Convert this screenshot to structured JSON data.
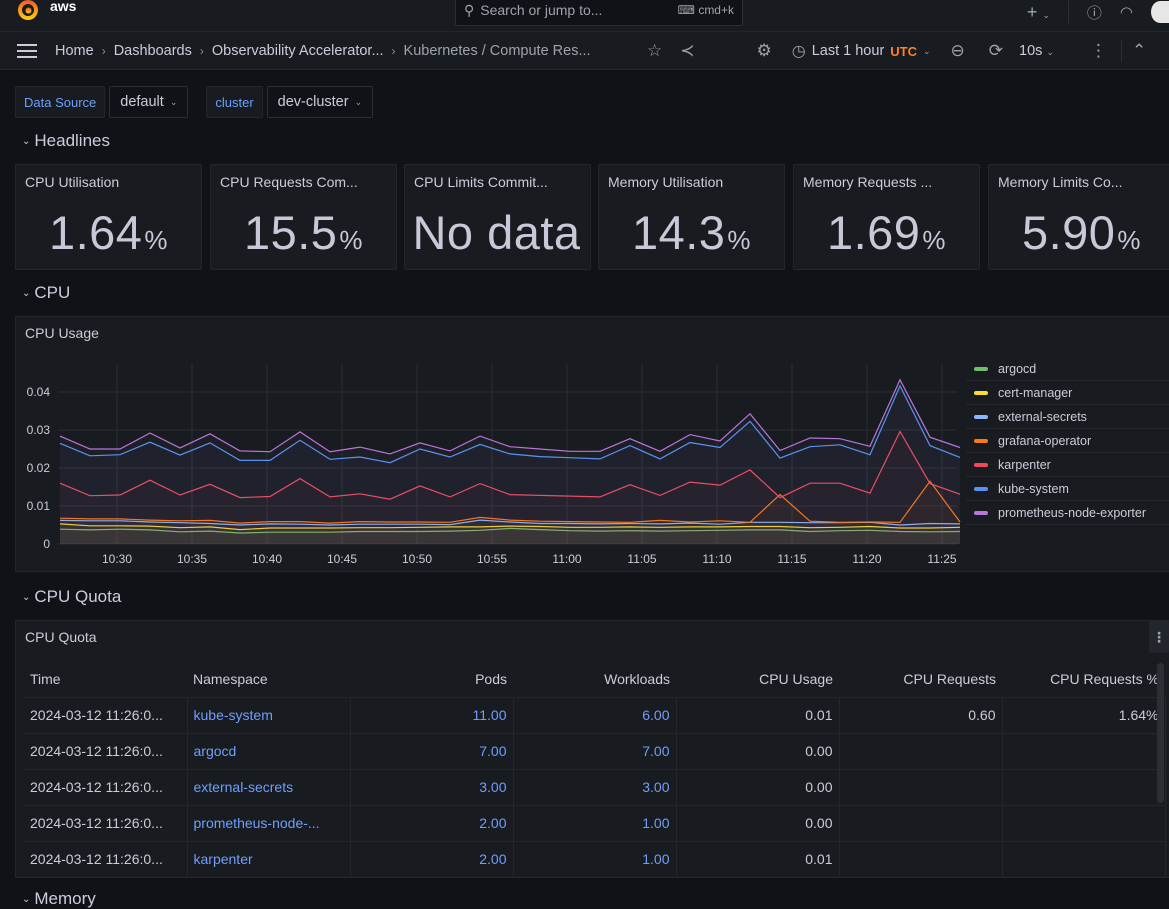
{
  "topbar": {
    "brand": "aws",
    "search_placeholder": "Search or jump to...",
    "search_shortcut": "cmd+k",
    "icons": [
      "grafana-logo-icon",
      "search-icon",
      "keyboard-icon",
      "plus-icon",
      "help-icon",
      "rss-icon",
      "avatar"
    ]
  },
  "navbar": {
    "breadcrumbs": [
      "Home",
      "Dashboards",
      "Observability Accelerator...",
      "Kubernetes / Compute Res..."
    ],
    "time_range": "Last 1 hour",
    "timezone": "UTC",
    "refresh_interval": "10s",
    "accent_utc": "#ff7f2a"
  },
  "variables": [
    {
      "label": "Data Source",
      "value": "default"
    },
    {
      "label": "cluster",
      "value": "dev-cluster"
    }
  ],
  "rows": {
    "headlines": "Headlines",
    "cpu": "CPU",
    "cpu_quota": "CPU Quota",
    "memory": "Memory"
  },
  "stats": [
    {
      "title": "CPU Utilisation",
      "value": "1.64",
      "unit": "%"
    },
    {
      "title": "CPU Requests Com...",
      "value": "15.5",
      "unit": "%"
    },
    {
      "title": "CPU Limits Commit...",
      "value": "No data",
      "unit": ""
    },
    {
      "title": "Memory Utilisation",
      "value": "14.3",
      "unit": "%"
    },
    {
      "title": "Memory Requests ...",
      "value": "1.69",
      "unit": "%"
    },
    {
      "title": "Memory Limits Co...",
      "value": "5.90",
      "unit": "%"
    }
  ],
  "cpu_usage_panel": {
    "title": "CPU Usage"
  },
  "chart_data": {
    "type": "line",
    "title": "CPU Usage",
    "xlabel": "",
    "ylabel": "",
    "ylim": [
      0,
      0.045
    ],
    "yticks": [
      "0",
      "0.01",
      "0.02",
      "0.03",
      "0.04"
    ],
    "xticks": [
      "10:30",
      "10:35",
      "10:40",
      "10:45",
      "10:50",
      "10:55",
      "11:00",
      "11:05",
      "11:10",
      "11:15",
      "11:20",
      "11:25"
    ],
    "x_start_minutes": 26.2,
    "x_step_minutes": 2,
    "grid": true,
    "legend": "right",
    "series": [
      {
        "name": "argocd",
        "color": "#73bf69",
        "values": [
          0.0039,
          0.0037,
          0.0039,
          0.0037,
          0.0032,
          0.0034,
          0.0029,
          0.0031,
          0.0031,
          0.0031,
          0.0033,
          0.0033,
          0.0033,
          0.0034,
          0.0036,
          0.0041,
          0.0038,
          0.0035,
          0.0034,
          0.0035,
          0.0034,
          0.0035,
          0.0036,
          0.0037,
          0.0037,
          0.0033,
          0.0035,
          0.0036,
          0.0033,
          0.0032,
          0.0033
        ]
      },
      {
        "name": "cert-manager",
        "color": "#fade2a",
        "values": [
          0.0053,
          0.0048,
          0.0048,
          0.0047,
          0.0043,
          0.0045,
          0.0038,
          0.0042,
          0.0042,
          0.0042,
          0.0043,
          0.0043,
          0.0044,
          0.0045,
          0.0045,
          0.0047,
          0.0046,
          0.0044,
          0.0044,
          0.0045,
          0.0044,
          0.0045,
          0.0045,
          0.0046,
          0.0046,
          0.0043,
          0.0044,
          0.0046,
          0.0042,
          0.0042,
          0.0044
        ]
      },
      {
        "name": "external-secrets",
        "color": "#8ab8ff",
        "values": [
          0.0062,
          0.0061,
          0.0061,
          0.0058,
          0.0056,
          0.0054,
          0.005,
          0.0053,
          0.0052,
          0.005,
          0.0052,
          0.0052,
          0.0052,
          0.0051,
          0.0063,
          0.0058,
          0.0054,
          0.0054,
          0.0053,
          0.0054,
          0.0053,
          0.0055,
          0.0052,
          0.0057,
          0.0057,
          0.0056,
          0.0056,
          0.0057,
          0.005,
          0.0054,
          0.0053
        ]
      },
      {
        "name": "grafana-operator",
        "color": "#ff780a",
        "values": [
          0.0068,
          0.0066,
          0.0066,
          0.0063,
          0.0061,
          0.0062,
          0.0055,
          0.0059,
          0.0059,
          0.0055,
          0.0059,
          0.0058,
          0.0058,
          0.0057,
          0.007,
          0.0063,
          0.006,
          0.0059,
          0.0058,
          0.0057,
          0.0062,
          0.0058,
          0.0061,
          0.0057,
          0.013,
          0.006,
          0.0057,
          0.0058,
          0.0057,
          0.0165,
          0.0058
        ]
      },
      {
        "name": "karpenter",
        "color": "#f2495c",
        "values": [
          0.016,
          0.0127,
          0.0129,
          0.0168,
          0.0129,
          0.0157,
          0.0122,
          0.0125,
          0.0172,
          0.0124,
          0.0132,
          0.0118,
          0.0153,
          0.0124,
          0.0159,
          0.013,
          0.0128,
          0.0126,
          0.0124,
          0.0156,
          0.0128,
          0.0163,
          0.0155,
          0.0195,
          0.0122,
          0.016,
          0.016,
          0.0134,
          0.0296,
          0.0159,
          0.0131
        ]
      },
      {
        "name": "kube-system",
        "color": "#5794f2",
        "values": [
          0.0265,
          0.0232,
          0.0235,
          0.0268,
          0.0234,
          0.0266,
          0.022,
          0.022,
          0.0273,
          0.0223,
          0.0229,
          0.0214,
          0.025,
          0.0229,
          0.0262,
          0.0237,
          0.023,
          0.0227,
          0.0224,
          0.0259,
          0.0224,
          0.0267,
          0.0254,
          0.0323,
          0.0226,
          0.0256,
          0.0261,
          0.0235,
          0.0416,
          0.0259,
          0.0228
        ]
      },
      {
        "name": "prometheus-node-exporter",
        "color": "#b877d9",
        "values": [
          0.0284,
          0.025,
          0.025,
          0.0292,
          0.0253,
          0.029,
          0.0245,
          0.0243,
          0.0295,
          0.0243,
          0.0255,
          0.0237,
          0.0266,
          0.0245,
          0.0284,
          0.0256,
          0.025,
          0.0244,
          0.0244,
          0.0277,
          0.0244,
          0.0288,
          0.0271,
          0.0343,
          0.0246,
          0.0279,
          0.0277,
          0.0257,
          0.0432,
          0.0281,
          0.0254
        ]
      }
    ]
  },
  "cpu_quota_panel": {
    "title": "CPU Quota",
    "columns": [
      "Time",
      "Namespace",
      "Pods",
      "Workloads",
      "CPU Usage",
      "CPU Requests",
      "CPU Requests %"
    ],
    "rows": [
      [
        "2024-03-12 11:26:0...",
        "kube-system",
        "11.00",
        "6.00",
        "0.01",
        "0.60",
        "1.64%"
      ],
      [
        "2024-03-12 11:26:0...",
        "argocd",
        "7.00",
        "7.00",
        "0.00",
        "",
        ""
      ],
      [
        "2024-03-12 11:26:0...",
        "external-secrets",
        "3.00",
        "3.00",
        "0.00",
        "",
        ""
      ],
      [
        "2024-03-12 11:26:0...",
        "prometheus-node-...",
        "2.00",
        "1.00",
        "0.00",
        "",
        ""
      ],
      [
        "2024-03-12 11:26:0...",
        "karpenter",
        "2.00",
        "1.00",
        "0.01",
        "",
        ""
      ]
    ]
  }
}
